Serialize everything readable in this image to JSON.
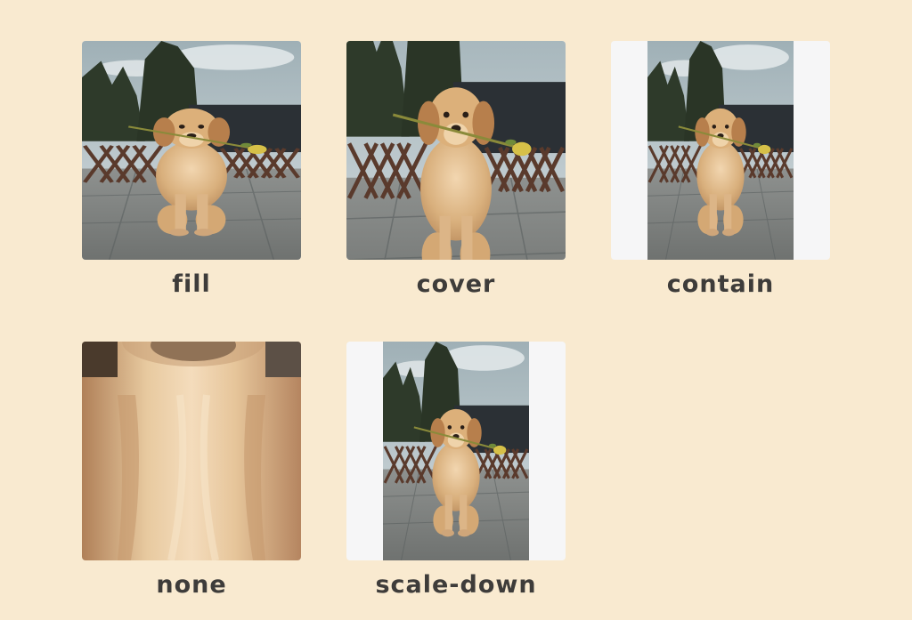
{
  "colors": {
    "page_background": "#f9ead0",
    "letterbox": "#f6f6f7",
    "label_text": "#3e3c3a"
  },
  "examples": [
    {
      "label": "fill",
      "image": "golden-retriever-puppy-with-flower"
    },
    {
      "label": "cover",
      "image": "golden-retriever-puppy-with-flower"
    },
    {
      "label": "contain",
      "image": "golden-retriever-puppy-with-flower"
    },
    {
      "label": "none",
      "image": "golden-retriever-puppy-closeup"
    },
    {
      "label": "scale-down",
      "image": "golden-retriever-puppy-with-flower"
    }
  ]
}
